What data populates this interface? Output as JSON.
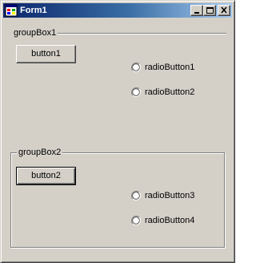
{
  "window": {
    "title": "Form1",
    "icon": "form-app-icon",
    "controls": [
      "minimize-icon",
      "maximize-icon",
      "close-icon"
    ]
  },
  "group_box_1": {
    "label": "groupBox1",
    "button": "button1",
    "radios": [
      "radioButton1",
      "radioButton2"
    ]
  },
  "group_box_2": {
    "label": "groupBox2",
    "button": "button2",
    "radios": [
      "radioButton3",
      "radioButton4"
    ]
  },
  "colors": {
    "titlebar_start": "#0a246a",
    "titlebar_end": "#a6caf0",
    "face": "#d4d0c8"
  }
}
